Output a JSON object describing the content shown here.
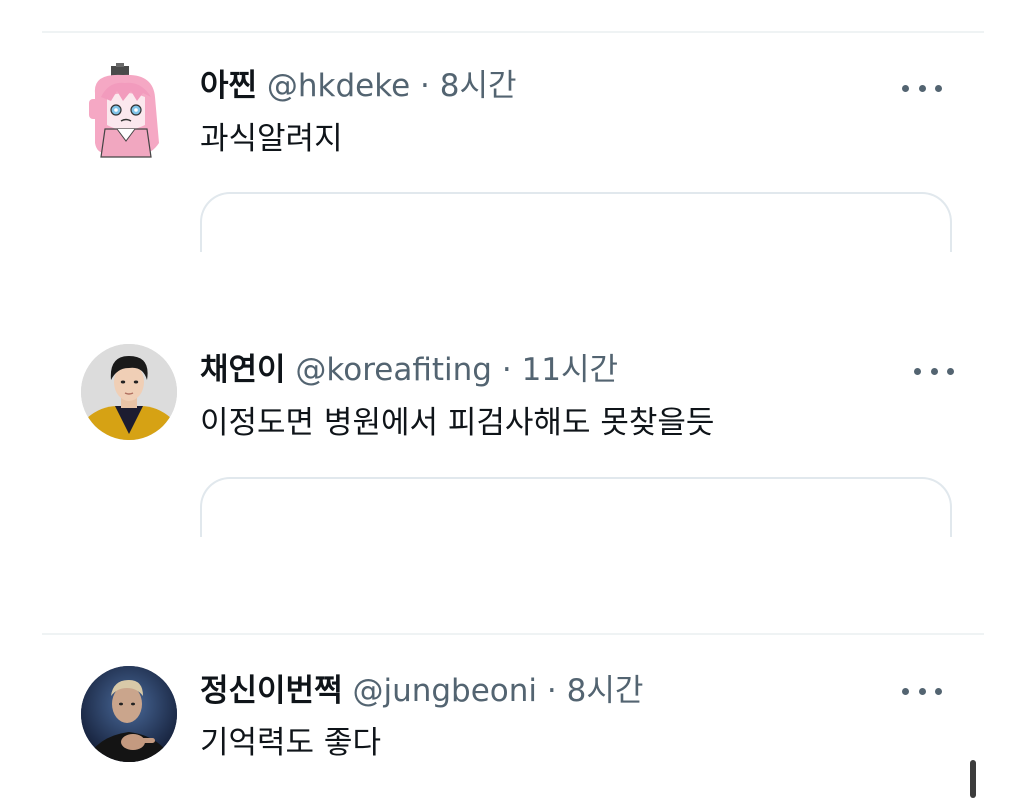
{
  "posts": [
    {
      "display_name": "아찐",
      "handle": "@hkdeke",
      "separator": "·",
      "time": "8시간",
      "text": "과식알려지",
      "avatar_icon": "pink-haired-anime-girl-avatar"
    },
    {
      "display_name": "채연이",
      "handle": "@koreafiting",
      "separator": "·",
      "time": "11시간",
      "text": "이정도면 병원에서 피검사해도 못찾을듯",
      "avatar_icon": "young-man-photo-avatar"
    },
    {
      "display_name": "정신이번쩍",
      "handle": "@jungbeoni",
      "separator": "·",
      "time": "8시간",
      "text": "기억력도 좋다",
      "avatar_icon": "man-pointing-photo-avatar"
    }
  ],
  "colors": {
    "text_primary": "#0f1419",
    "text_secondary": "#536471",
    "divider": "#eff3f4",
    "card_border": "#e1e8ed"
  }
}
